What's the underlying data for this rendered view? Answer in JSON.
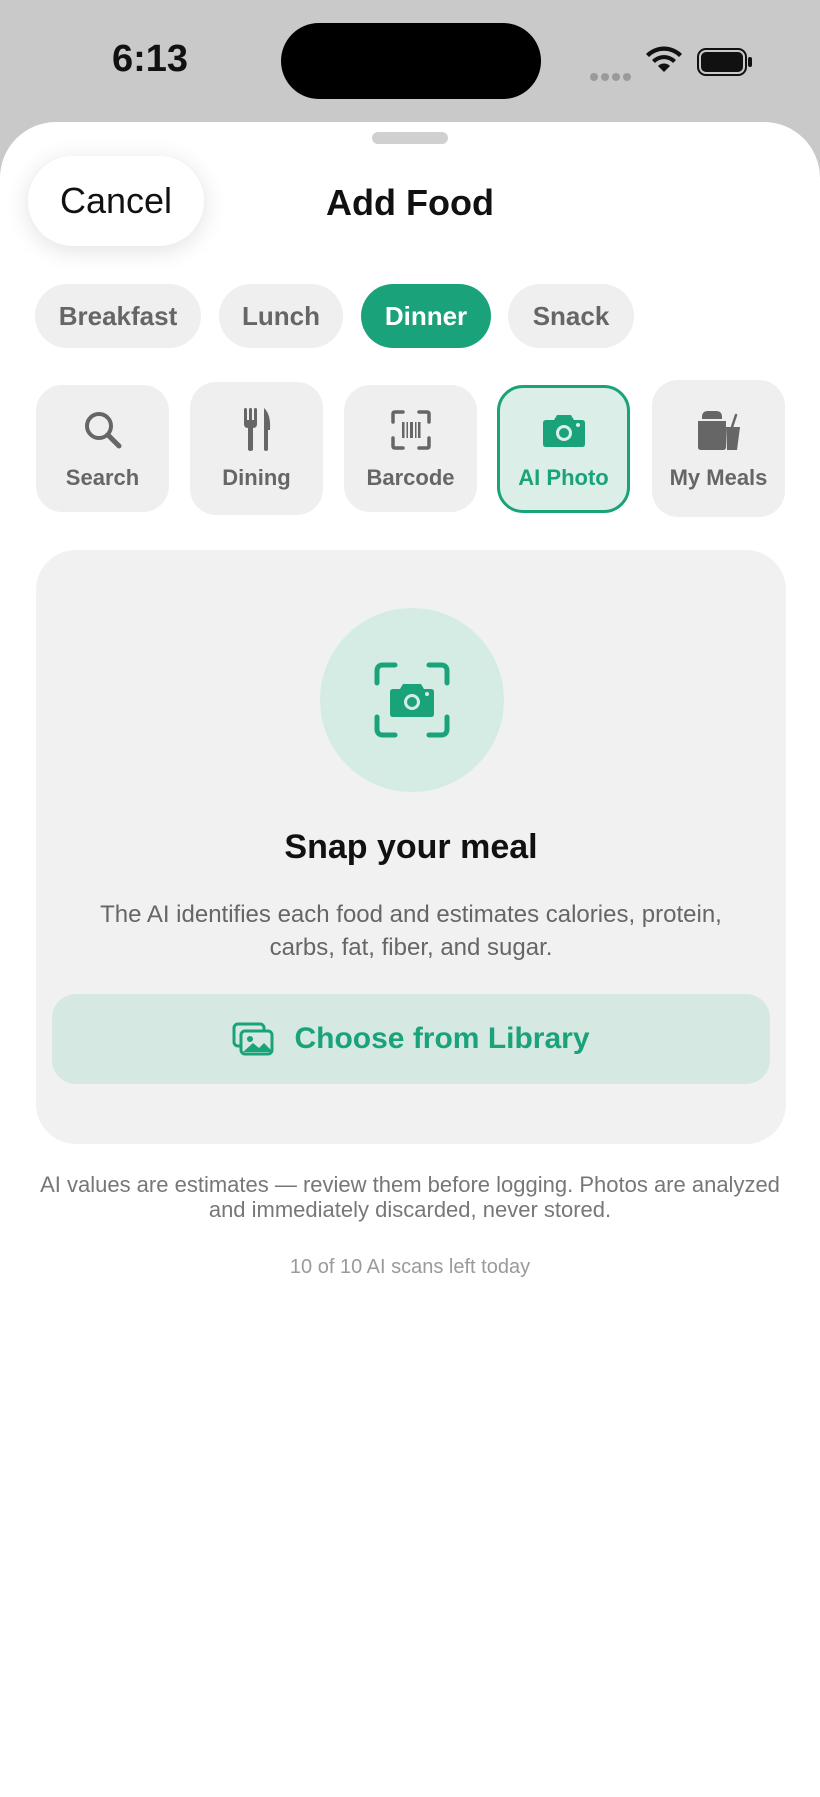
{
  "status_bar": {
    "time": "6:13"
  },
  "header": {
    "cancel_label": "Cancel",
    "title": "Add Food"
  },
  "meal_chips": [
    {
      "label": "Breakfast",
      "active": false
    },
    {
      "label": "Lunch",
      "active": false
    },
    {
      "label": "Dinner",
      "active": true
    },
    {
      "label": "Snack",
      "active": false
    }
  ],
  "modes": [
    {
      "label": "Search",
      "icon": "search-icon",
      "active": false
    },
    {
      "label": "Dining",
      "icon": "fork-knife-icon",
      "active": false
    },
    {
      "label": "Barcode",
      "icon": "barcode-scan-icon",
      "active": false
    },
    {
      "label": "AI Photo",
      "icon": "camera-icon",
      "active": true
    },
    {
      "label": "My Meals",
      "icon": "takeout-bag-icon",
      "active": false
    }
  ],
  "photo_card": {
    "title": "Snap your meal",
    "description": "The AI identifies each food and estimates calories, protein, carbs, fat, fiber, and sugar.",
    "library_button_label": "Choose from Library"
  },
  "disclaimer": "AI values are estimates — review them before logging. Photos are analyzed and immediately discarded, never stored.",
  "scans_left": "10 of 10 AI scans left today",
  "colors": {
    "accent": "#1aa37a",
    "accent_light": "#d5ece4",
    "chip_bg": "#efefef"
  }
}
